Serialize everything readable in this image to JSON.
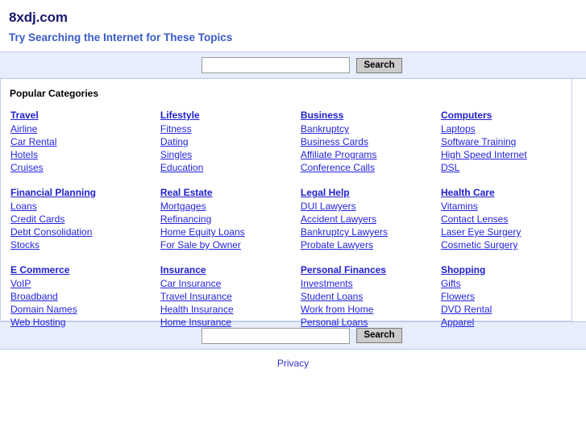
{
  "header": {
    "site_title": "8xdj.com",
    "tagline": "Try Searching the Internet for These Topics"
  },
  "search_top": {
    "name": "top-search",
    "value": "",
    "placeholder": "",
    "button_label": "Search"
  },
  "search_bottom": {
    "name": "bottom-search",
    "value": "",
    "placeholder": "",
    "button_label": "Search"
  },
  "main": {
    "popular_heading": "Popular Categories",
    "rows": [
      [
        {
          "title": "Travel",
          "links": [
            "Airline",
            "Car Rental",
            "Hotels",
            "Cruises"
          ]
        },
        {
          "title": "Lifestyle",
          "links": [
            "Fitness",
            "Dating",
            "Singles",
            "Education"
          ]
        },
        {
          "title": "Business",
          "links": [
            "Bankruptcy",
            "Business Cards",
            "Affiliate Programs",
            "Conference Calls"
          ]
        },
        {
          "title": "Computers",
          "links": [
            "Laptops",
            "Software Training",
            "High Speed Internet",
            "DSL"
          ]
        }
      ],
      [
        {
          "title": "Financial Planning",
          "links": [
            "Loans",
            "Credit Cards",
            "Debt Consolidation",
            "Stocks"
          ]
        },
        {
          "title": "Real Estate",
          "links": [
            "Mortgages",
            "Refinancing",
            "Home Equity Loans",
            "For Sale by Owner"
          ]
        },
        {
          "title": "Legal Help",
          "links": [
            "DUI Lawyers",
            "Accident Lawyers",
            "Bankruptcy Lawyers",
            "Probate Lawyers"
          ]
        },
        {
          "title": "Health Care",
          "links": [
            "Vitamins",
            "Contact Lenses",
            "Laser Eye Surgery",
            "Cosmetic Surgery"
          ]
        }
      ],
      [
        {
          "title": "E Commerce",
          "links": [
            "VoIP",
            "Broadband",
            "Domain Names",
            "Web Hosting"
          ]
        },
        {
          "title": "Insurance",
          "links": [
            "Car Insurance",
            "Travel Insurance",
            "Health Insurance",
            "Home Insurance"
          ]
        },
        {
          "title": "Personal Finances",
          "links": [
            "Investments",
            "Student Loans",
            "Work from Home",
            "Personal Loans"
          ]
        },
        {
          "title": "Shopping",
          "links": [
            "Gifts",
            "Flowers",
            "DVD Rental",
            "Apparel"
          ]
        }
      ]
    ]
  },
  "footer": {
    "privacy_label": "Privacy"
  },
  "colors": {
    "title": "#191970",
    "tagline": "#3a5bc7",
    "link": "#2424dd",
    "strip_bg": "#e7edfa",
    "strip_border": "#b9c9ec",
    "box_border": "#c3d0ea",
    "button_bg": "#cccccc"
  }
}
